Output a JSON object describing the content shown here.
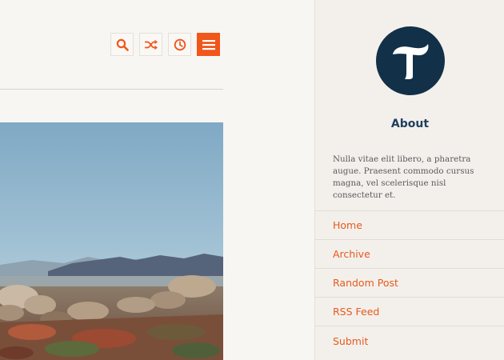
{
  "toolbar": {
    "icons": [
      "search-icon",
      "shuffle-icon",
      "clock-icon",
      "menu-icon"
    ],
    "accent": "#f1561a"
  },
  "sidebar": {
    "logo_letter": "T",
    "about_title": "About",
    "about_text": "Nulla vitae elit libero, a pharetra augue. Praesent commodo cursus magna, vel scelerisque nisl consectetur et.",
    "nav": [
      {
        "label": "Home"
      },
      {
        "label": "Archive"
      },
      {
        "label": "Random Post"
      },
      {
        "label": "RSS Feed"
      },
      {
        "label": "Submit"
      }
    ]
  },
  "colors": {
    "link": "#e7591d",
    "logo_bg": "#133049",
    "heading": "#1f3f5e"
  }
}
